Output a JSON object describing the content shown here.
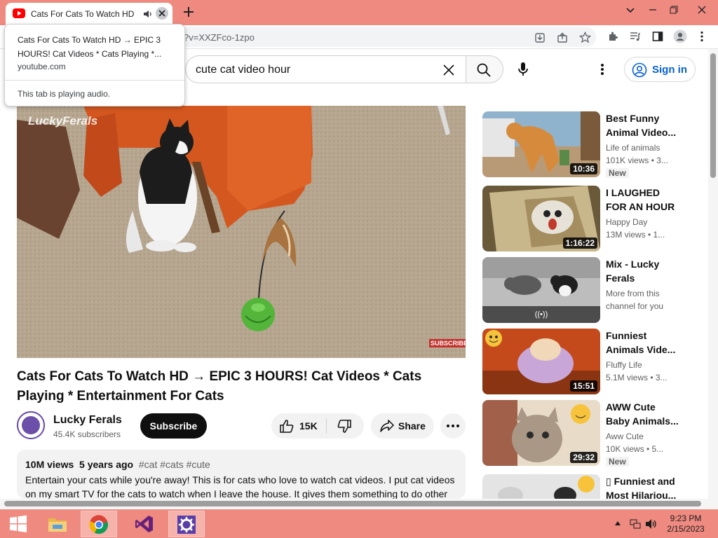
{
  "browser": {
    "tab": {
      "title": "Cats For Cats To Watch HD",
      "title_suffix": "→",
      "audio_icon": "speaker-icon"
    },
    "address": {
      "url_visible": "?v=XXZFco-1zpo"
    },
    "hover_card": {
      "title": "Cats For Cats To Watch HD → EPIC 3 HOURS! Cat Videos * Cats Playing *...",
      "domain": "youtube.com",
      "audio_status": "This tab is playing audio."
    }
  },
  "youtube": {
    "search": {
      "query": "cute cat video hour"
    },
    "sign_in_label": "Sign in",
    "video": {
      "watermark": "LuckyFerals",
      "subscribe_watermark": "SUBSCRIBE",
      "title": "Cats For Cats To Watch HD → EPIC 3 HOURS! Cat Videos * Cats Playing * Entertainment For Cats",
      "channel": "Lucky Ferals",
      "avatar_text": "Lucky Ferals",
      "subscribers": "45.4K subscribers",
      "subscribe_label": "Subscribe",
      "likes": "15K",
      "share_label": "Share",
      "views": "10M views",
      "age": "5 years ago",
      "tags": "#cat #cats #cute",
      "description": "Entertain your cats while you're away! This is for cats who love to watch cat videos. I put cat videos on my smart TV for the cats to watch when I leave the house. It gives them something to do other"
    },
    "recommendations": [
      {
        "title": "Best Funny Animal Video...",
        "channel": "Life of animals",
        "views": "101K views • 3...",
        "duration": "10:36",
        "badge": "New"
      },
      {
        "title": "I LAUGHED FOR AN HOUR😺...",
        "channel": "Happy Day",
        "views": "13M views • 1...",
        "duration": "1:16:22",
        "badge": ""
      },
      {
        "title": "Mix - Lucky Ferals",
        "channel": "More from this",
        "views": "channel for you",
        "duration": "",
        "badge": ""
      },
      {
        "title": "Funniest Animals Vide...",
        "channel": "Fluffy Life",
        "views": "5.1M views • 3...",
        "duration": "15:51",
        "badge": ""
      },
      {
        "title": "AWW Cute Baby Animals...",
        "channel": "Aww Cute",
        "views": "10K views • 5...",
        "duration": "29:32",
        "badge": "New"
      },
      {
        "title": "▯ Funniest and Most Hilariou...",
        "channel": "",
        "views": "",
        "duration": "",
        "badge": ""
      }
    ]
  },
  "taskbar": {
    "time": "9:23 PM",
    "date": "2/15/2023",
    "apps": [
      "file-explorer-icon",
      "chrome-icon",
      "visual-studio-icon",
      "settings-gear-icon"
    ]
  },
  "colors": {
    "chrome_frame": "#ef8a80",
    "youtube_red": "#ff0000",
    "link_blue": "#065fd4"
  }
}
